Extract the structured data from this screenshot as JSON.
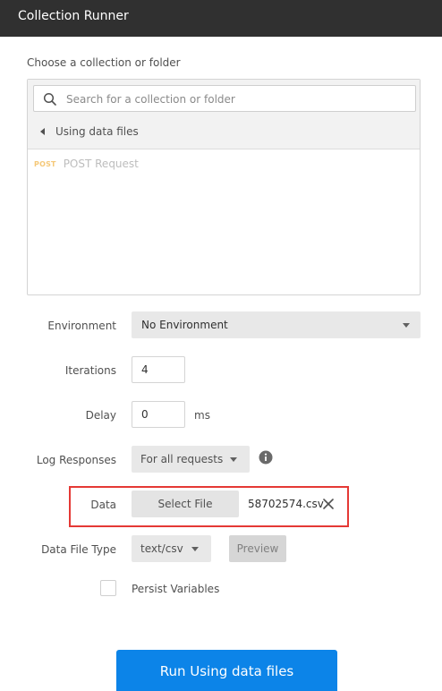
{
  "window": {
    "title": "Collection Runner"
  },
  "collection": {
    "label": "Choose a collection or folder",
    "search_placeholder": "Search for a collection or folder",
    "back_label": "Using data files",
    "requests": [
      {
        "method": "POST",
        "name": "POST Request"
      }
    ]
  },
  "settings": {
    "environment": {
      "label": "Environment",
      "value": "No Environment"
    },
    "iterations": {
      "label": "Iterations",
      "value": "4"
    },
    "delay": {
      "label": "Delay",
      "value": "0",
      "unit": "ms"
    },
    "log_responses": {
      "label": "Log Responses",
      "value": "For all requests"
    },
    "data": {
      "label": "Data",
      "button_label": "Select File",
      "file_name": "58702574.csv"
    },
    "data_file_type": {
      "label": "Data File Type",
      "value": "text/csv",
      "preview_label": "Preview"
    },
    "persist_variables": {
      "label": "Persist Variables",
      "checked": false
    }
  },
  "run_button": {
    "label": "Run Using data files"
  },
  "colors": {
    "accent": "#0c84e8",
    "titlebar": "#303030",
    "highlight": "#e53935",
    "method_post": "#f5c878"
  }
}
